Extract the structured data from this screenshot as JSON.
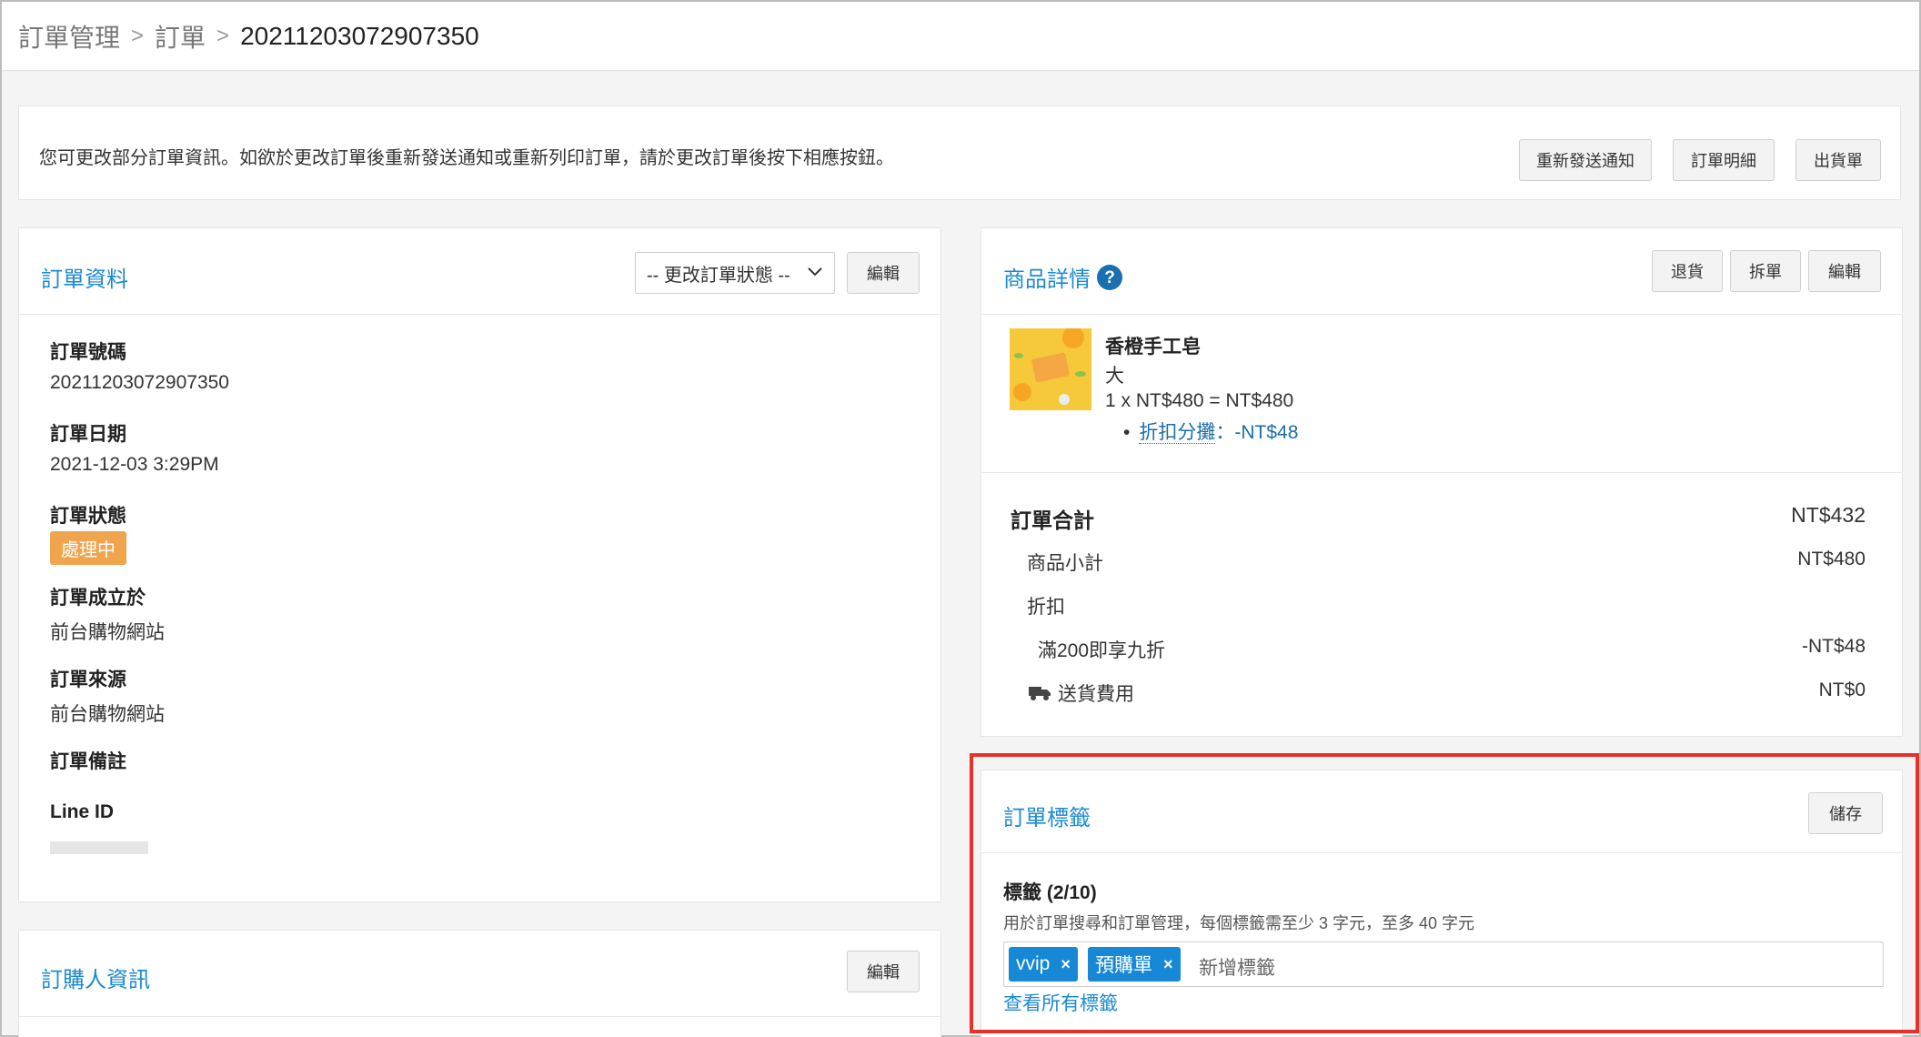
{
  "breadcrumb": {
    "items": [
      "訂單管理",
      "訂單",
      "20211203072907350"
    ]
  },
  "notice": {
    "text": "您可更改部分訂單資訊。如欲於更改訂單後重新發送通知或重新列印訂單，請於更改訂單後按下相應按鈕。",
    "resend_label": "重新發送通知",
    "details_label": "訂單明細",
    "shipping_label": "出貨單"
  },
  "order_info": {
    "title": "訂單資料",
    "status_select": "-- 更改訂單狀態 --",
    "edit_label": "編輯",
    "fields": {
      "number_label": "訂單號碼",
      "number_value": "20211203072907350",
      "date_label": "訂單日期",
      "date_value": "2021-12-03 3:29PM",
      "status_label": "訂單狀態",
      "status_value": "處理中",
      "created_at_label": "訂單成立於",
      "created_at_value": "前台購物網站",
      "source_label": "訂單來源",
      "source_value": "前台購物網站",
      "remarks_label": "訂單備註",
      "line_id_label": "Line ID"
    }
  },
  "buyer_info": {
    "title": "訂購人資訊",
    "edit_label": "編輯"
  },
  "product": {
    "title": "商品詳情",
    "return_label": "退貨",
    "split_label": "拆單",
    "edit_label": "編輯",
    "name": "香橙手工皂",
    "variant": "大",
    "price_line": "1 x NT$480 = NT$480",
    "discount_label": "折扣分攤",
    "discount_sep": "：",
    "discount_value": "-NT$48"
  },
  "summary": {
    "total_label": "訂單合計",
    "total_value": "NT$432",
    "subtotal_label": "商品小計",
    "subtotal_value": "NT$480",
    "discount_label": "折扣",
    "promo_label": "滿200即享九折",
    "promo_value": "-NT$48",
    "shipping_label": "送貨費用",
    "shipping_value": "NT$0"
  },
  "tags": {
    "title": "訂單標籤",
    "save_label": "儲存",
    "field_label": "標籤 (2/10)",
    "help": "用於訂單搜尋和訂單管理，每個標籤需至少 3 字元，至多 40 字元",
    "items": [
      {
        "label": "vvip"
      },
      {
        "label": "預購單"
      }
    ],
    "placeholder": "新增標籤",
    "view_all": "查看所有標籤"
  },
  "colors": {
    "accent": "#1a8ad0",
    "status_badge": "#f0a54c",
    "tag_chip": "#1688d6",
    "highlight": "#e43129"
  }
}
